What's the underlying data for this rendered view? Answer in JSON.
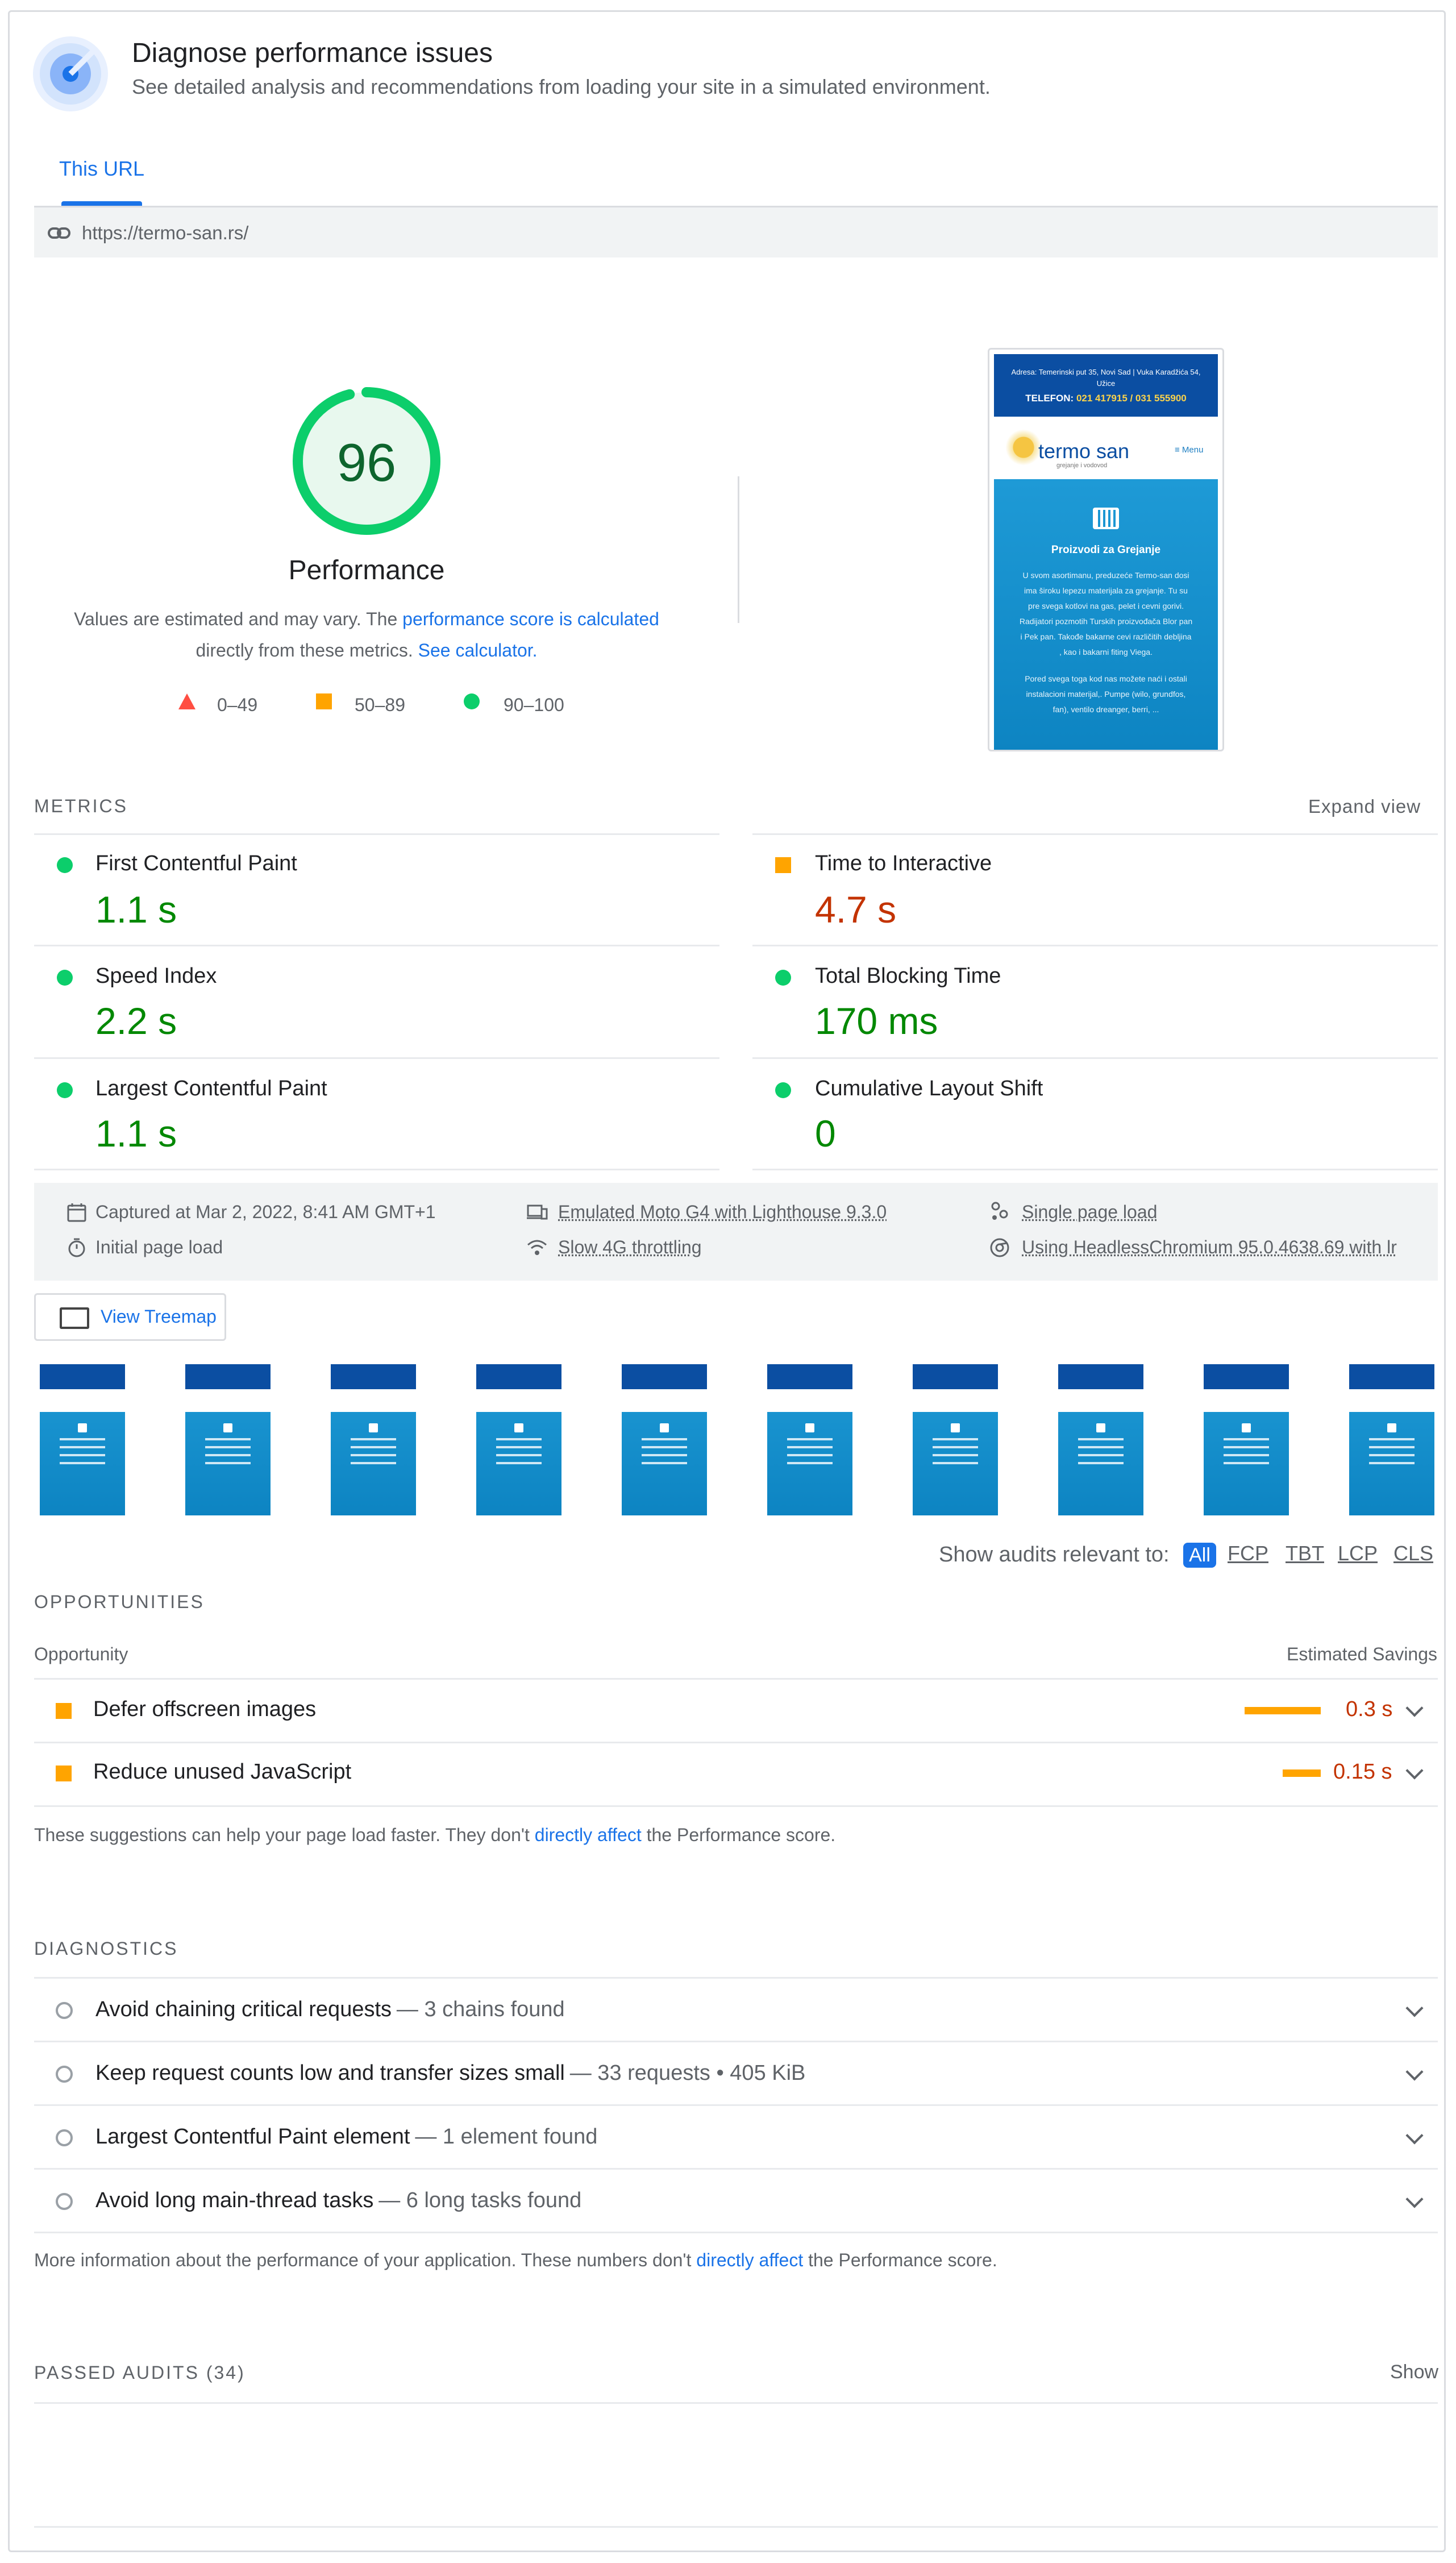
{
  "header": {
    "title": "Diagnose performance issues",
    "subtitle": "See detailed analysis and recommendations from loading your site in a simulated environment."
  },
  "tabs": [
    {
      "label": "This URL",
      "active": true
    }
  ],
  "url": "https://termo-san.rs/",
  "score": {
    "value": "96",
    "fraction": 0.96,
    "label": "Performance",
    "desc_pre": "Values are estimated and may vary. The ",
    "desc_link1": "performance score is calculated",
    "desc_mid": "directly from these metrics. ",
    "desc_link2": "See calculator.",
    "color": "#0cce6b"
  },
  "legend": [
    {
      "icon": "fail-triangle-icon",
      "label": "0–49",
      "color": "#ff4e42"
    },
    {
      "icon": "average-square-icon",
      "label": "50–89",
      "color": "#ffa400"
    },
    {
      "icon": "pass-circle-icon",
      "label": "90–100",
      "color": "#0cce6b"
    }
  ],
  "screenshot": {
    "address": "Adresa: Temerinski put 35, Novi Sad | Vuka Karadžića 54, Užice",
    "phone_label": "TELEFON:",
    "phone_numbers": "021 417915 / 031 555900",
    "logo": "termo san",
    "logo_sub": "grejanje i vodovod",
    "menu": "≡ Menu",
    "heading": "Proizvodi za Grejanje",
    "para1": "U svom asortimanu, preduzeće Termo-san dosi ima široku lepezu materijala za grejanje. Tu su pre svega kotlovi na gas, pelet i cevni gorivi. Radijatori pozmotih Turskih proizvođača Blor pan i Pek pan. Takođe bakarne cevi različitih debljina , kao i bakarni fiting Viega.",
    "para2": "Pored svega toga kod nas možete naći i ostali instalacioni materijal,. Pumpe (wilo, grundfos, fan), ventilo dreanger, berri, ..."
  },
  "metrics": {
    "heading": "METRICS",
    "expand": "Expand view",
    "items": [
      {
        "label": "First Contentful Paint",
        "value": "1.1 s",
        "status": "pass"
      },
      {
        "label": "Time to Interactive",
        "value": "4.7 s",
        "status": "average"
      },
      {
        "label": "Speed Index",
        "value": "2.2 s",
        "status": "pass"
      },
      {
        "label": "Total Blocking Time",
        "value": "170 ms",
        "status": "pass"
      },
      {
        "label": "Largest Contentful Paint",
        "value": "1.1 s",
        "status": "pass"
      },
      {
        "label": "Cumulative Layout Shift",
        "value": "0",
        "status": "pass"
      }
    ]
  },
  "runinfo": {
    "captured": "Captured at Mar 2, 2022, 8:41 AM GMT+1",
    "device": "Emulated Moto G4 with Lighthouse 9.3.0",
    "session": "Single page load",
    "initial": "Initial page load",
    "throttle": "Slow 4G throttling",
    "browser": "Using HeadlessChromium 95.0.4638.69 with lr"
  },
  "treemap_label": "View Treemap",
  "filmstrip_count": 10,
  "filter": {
    "label": "Show audits relevant to:",
    "chips": [
      "All",
      "FCP",
      "TBT",
      "LCP",
      "CLS"
    ]
  },
  "opportunities": {
    "heading": "OPPORTUNITIES",
    "col_left": "Opportunity",
    "col_right": "Estimated Savings",
    "items": [
      {
        "title": "Defer offscreen images",
        "saving": "0.3 s",
        "seconds": 0.3
      },
      {
        "title": "Reduce unused JavaScript",
        "saving": "0.15 s",
        "seconds": 0.15
      }
    ],
    "note_pre": "These suggestions can help your page load faster. They don't ",
    "note_link": "directly affect",
    "note_post": " the Performance score."
  },
  "diagnostics": {
    "heading": "DIAGNOSTICS",
    "items": [
      {
        "title": "Avoid chaining critical requests",
        "detail": "— 3 chains found"
      },
      {
        "title": "Keep request counts low and transfer sizes small",
        "detail": "— 33 requests • 405 KiB"
      },
      {
        "title": "Largest Contentful Paint element",
        "detail": "— 1 element found"
      },
      {
        "title": "Avoid long main-thread tasks",
        "detail": "— 6 long tasks found"
      }
    ],
    "note_pre": "More information about the performance of your application. These numbers don't ",
    "note_link": "directly affect",
    "note_post": " the Performance score."
  },
  "passed": {
    "heading": "PASSED AUDITS",
    "count": "(34)",
    "show": "Show"
  }
}
